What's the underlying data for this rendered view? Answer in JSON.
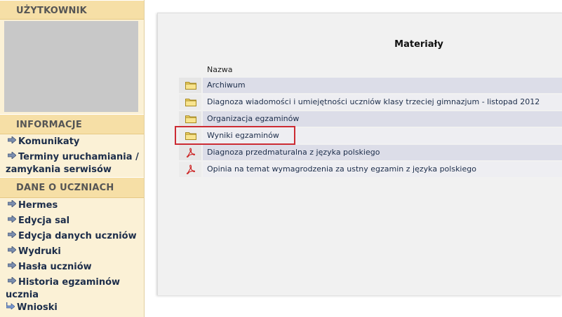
{
  "sidebar": {
    "user_header": "UŻYTKOWNIK",
    "info_header": "INFORMACJE",
    "info_items": [
      {
        "label": "Komunikaty"
      },
      {
        "label": "Terminy uruchamiania / zamykania serwisów"
      }
    ],
    "students_header": "DANE O UCZNIACH",
    "students_items": [
      {
        "label": "Hermes"
      },
      {
        "label": "Edycja sal"
      },
      {
        "label": "Edycja danych uczniów"
      },
      {
        "label": "Wydruki"
      },
      {
        "label": "Hasła uczniów"
      },
      {
        "label": "Historia egzaminów ucznia"
      },
      {
        "label": "Wnioski"
      }
    ]
  },
  "main": {
    "title": "Materiały",
    "column_name": "Nazwa",
    "rows": [
      {
        "type": "folder-icon",
        "name": "Archiwum"
      },
      {
        "type": "folder-icon",
        "name": "Diagnoza wiadomości i umiejętności uczniów klasy trzeciej gimnazjum - listopad 2012"
      },
      {
        "type": "folder-icon",
        "name": "Organizacja egzaminów"
      },
      {
        "type": "folder-icon",
        "name": "Wyniki egzaminów"
      },
      {
        "type": "pdf-icon",
        "name": "Diagnoza przedmaturalna z języka polskiego"
      },
      {
        "type": "pdf-icon",
        "name": "Opinia na temat wymagrodzenia za ustny egzamin z języka polskiego"
      }
    ]
  },
  "colors": {
    "sidebar_bg": "#fbf1d6",
    "section_header_bg": "#f6dfa6",
    "highlight_border": "#cc2b33",
    "link_color": "#1c2d4a"
  }
}
